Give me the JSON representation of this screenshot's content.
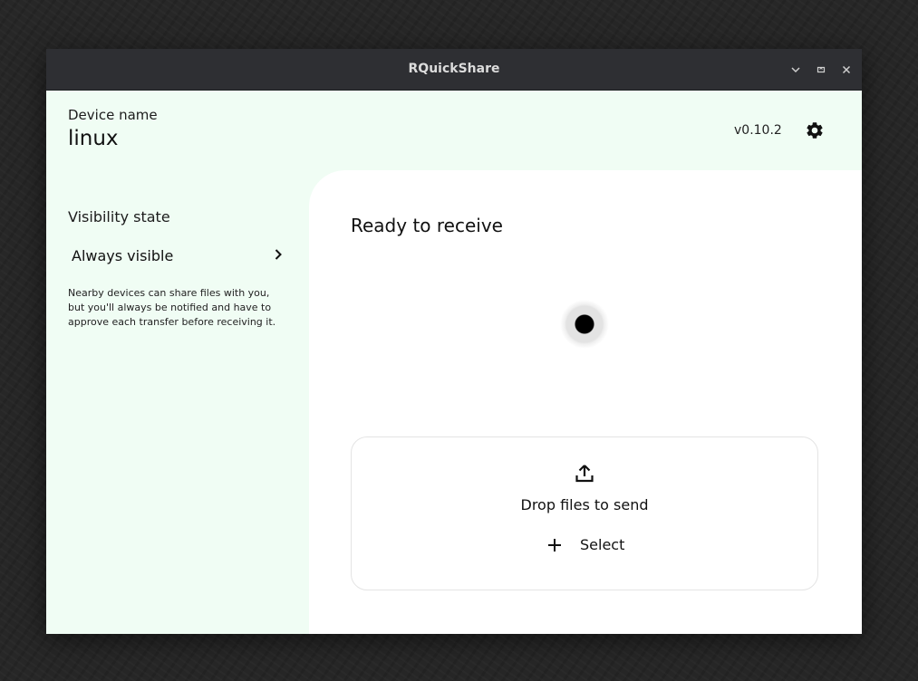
{
  "window": {
    "title": "RQuickShare",
    "controls": {
      "minimize_icon": "chevron-down-icon",
      "maximize_icon": "restore-icon",
      "close_icon": "close-icon"
    }
  },
  "header": {
    "device_label": "Device name",
    "device_name": "linux",
    "version": "v0.10.2",
    "settings_icon": "gear-icon"
  },
  "sidebar": {
    "visibility_title": "Visibility state",
    "visibility_value": "Always visible",
    "visibility_icon": "chevron-right-icon",
    "visibility_description": "Nearby devices can share files with you, but you'll always be notified and have to approve each transfer before receiving it."
  },
  "main": {
    "status": "Ready to receive",
    "dropzone": {
      "icon": "upload-icon",
      "text": "Drop files to send",
      "select_label": "Select",
      "select_icon": "plus-icon"
    }
  },
  "colors": {
    "accent_background": "#f0fdf4",
    "panel_background": "#ffffff",
    "titlebar": "#2e2f33",
    "desktop": "#272727"
  }
}
